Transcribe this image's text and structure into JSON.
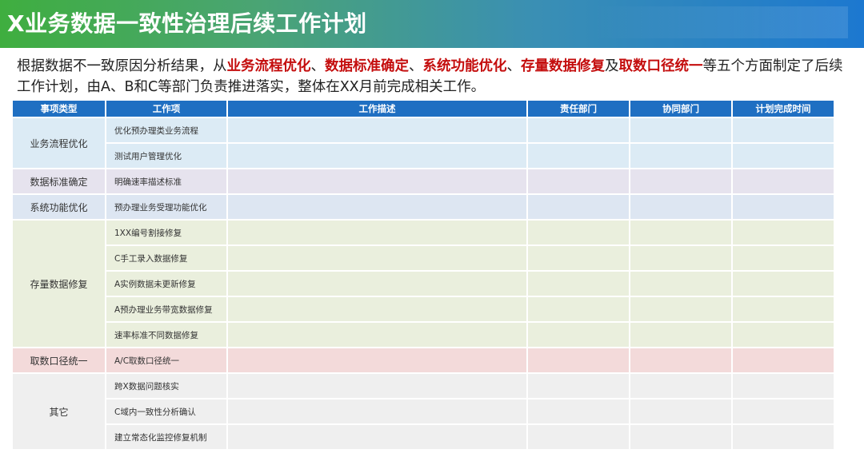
{
  "header": {
    "title": "X业务数据一致性治理后续工作计划"
  },
  "intro": {
    "prefix": "根据数据不一致原因分析结果，从",
    "h1": "业务流程优化",
    "sep1": "、",
    "h2": "数据标准确定",
    "sep2": "、",
    "h3": "系统功能优化",
    "sep3": "、",
    "h4": "存量数据修复",
    "mid": "及",
    "h5": "取数口径统一",
    "suffix": "等五个方面制定了后续工作计划，由A、B和C等部门负责推进落实，整体在XX月前完成相关工作。"
  },
  "table": {
    "headers": [
      "事项类型",
      "工作项",
      "工作描述",
      "责任部门",
      "协同部门",
      "计划完成时间"
    ],
    "groups": [
      {
        "category": "业务流程优化",
        "items": [
          "优化预办理类业务流程",
          "测试用户管理优化"
        ]
      },
      {
        "category": "数据标准确定",
        "items": [
          "明确速率描述标准"
        ]
      },
      {
        "category": "系统功能优化",
        "items": [
          "预办理业务受理功能优化"
        ]
      },
      {
        "category": "存量数据修复",
        "items": [
          "1XX编号割接修复",
          "C手工录入数据修复",
          "A实例数据未更新修复",
          "A预办理业务带宽数据修复",
          "速率标准不同数据修复"
        ]
      },
      {
        "category": "取数口径统一",
        "items": [
          "A/C取数口径统一"
        ]
      },
      {
        "category": "其它",
        "items": [
          "跨X数据问题核实",
          "C域内一致性分析确认",
          "建立常态化监控修复机制"
        ]
      }
    ]
  }
}
